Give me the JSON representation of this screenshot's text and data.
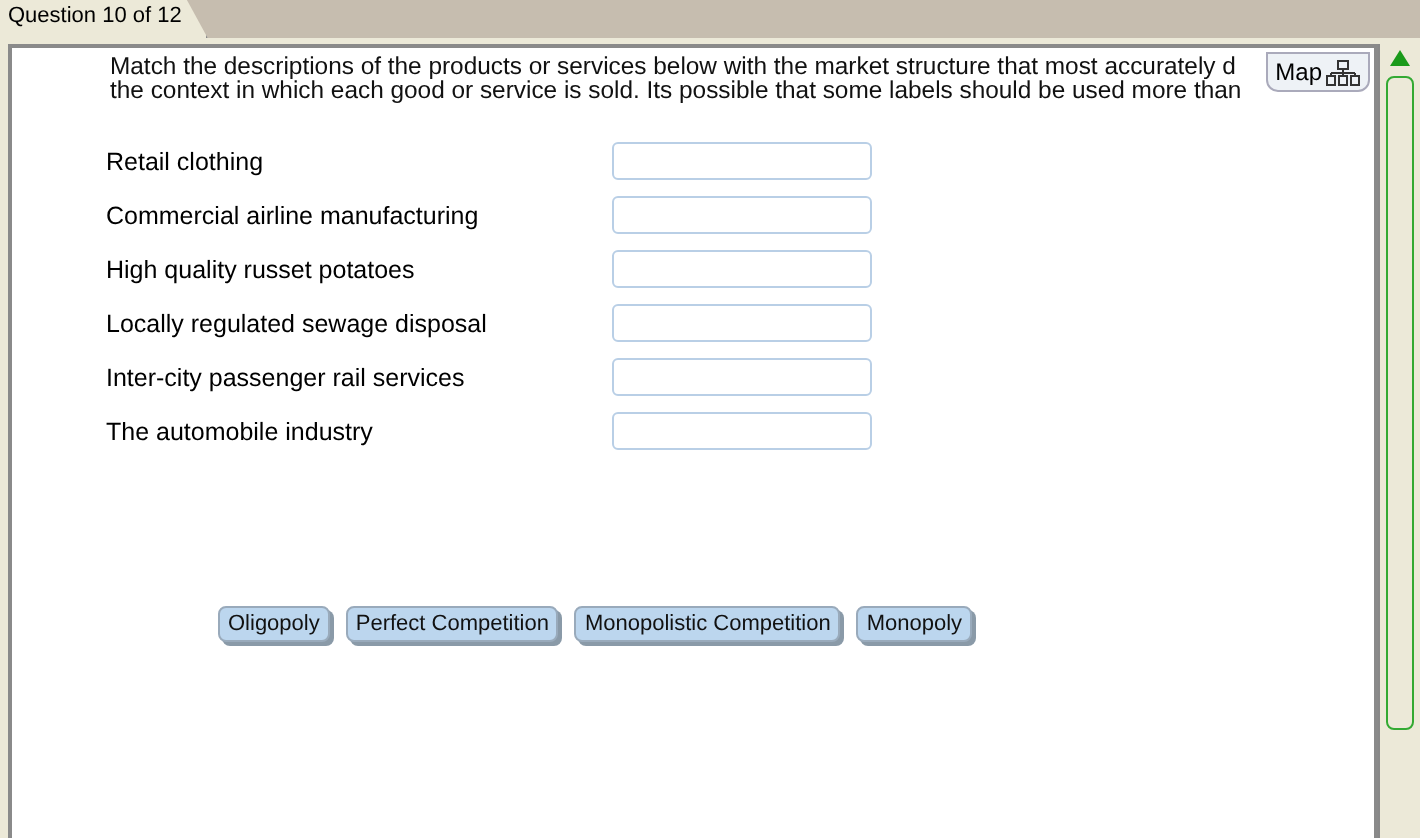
{
  "tab": {
    "label": "Question 10 of 12"
  },
  "instructions": [
    "Match the descriptions of the products or services below with the market structure that most accurately d",
    "the context in which each good or service is sold. Its possible that some labels should be used more than"
  ],
  "map_button": {
    "label": "Map"
  },
  "items": [
    {
      "label": "Retail clothing"
    },
    {
      "label": "Commercial airline manufacturing"
    },
    {
      "label": "High quality russet potatoes"
    },
    {
      "label": "Locally regulated sewage disposal"
    },
    {
      "label": "Inter-city passenger rail services"
    },
    {
      "label": "The automobile industry"
    }
  ],
  "choices": [
    "Oligopoly",
    "Perfect Competition",
    "Monopolistic Competition",
    "Monopoly"
  ]
}
